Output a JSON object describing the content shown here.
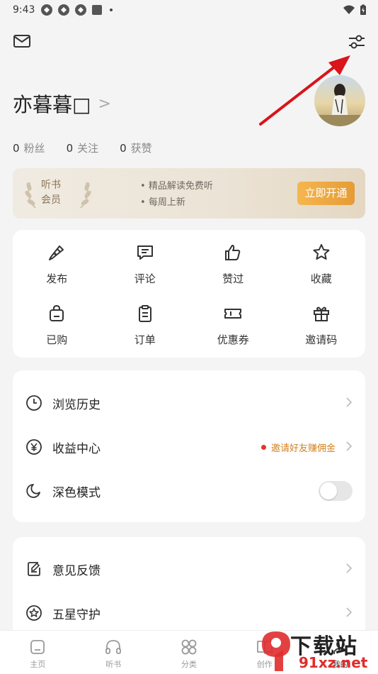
{
  "status_bar": {
    "time": "9:43"
  },
  "header": {
    "mail_icon": "mail-icon",
    "settings_icon": "sliders-icon"
  },
  "profile": {
    "name": "亦暮暮□",
    "chevron": ">"
  },
  "stats": [
    {
      "count": "0",
      "label": "粉丝"
    },
    {
      "count": "0",
      "label": "关注"
    },
    {
      "count": "0",
      "label": "获赞"
    }
  ],
  "vip_banner": {
    "title_line1": "听书",
    "title_line2": "会员",
    "perk1": "精品解读免费听",
    "perk2": "每周上新",
    "cta": "立即开通"
  },
  "quick_actions": [
    {
      "label": "发布",
      "icon": "pen-icon"
    },
    {
      "label": "评论",
      "icon": "comment-icon"
    },
    {
      "label": "赞过",
      "icon": "thumbs-up-icon"
    },
    {
      "label": "收藏",
      "icon": "star-icon"
    },
    {
      "label": "已购",
      "icon": "bag-icon"
    },
    {
      "label": "订单",
      "icon": "clipboard-icon"
    },
    {
      "label": "优惠券",
      "icon": "ticket-icon"
    },
    {
      "label": "邀请码",
      "icon": "gift-icon"
    }
  ],
  "menu": {
    "history": "浏览历史",
    "earnings": "收益中心",
    "earnings_hint": "邀请好友赚佣金",
    "dark_mode": "深色模式",
    "dark_mode_on": false,
    "feedback": "意见反馈",
    "five_star": "五星守护"
  },
  "tab_bar": [
    {
      "label": "主页",
      "icon": "home-icon"
    },
    {
      "label": "听书",
      "icon": "headphones-icon"
    },
    {
      "label": "分类",
      "icon": "grid-icon"
    },
    {
      "label": "创作",
      "icon": "book-icon"
    },
    {
      "label": "我的",
      "icon": "user-icon"
    }
  ],
  "watermark": {
    "text": "下载站",
    "url": "91xz.net"
  },
  "colors": {
    "accent": "#e69b36",
    "hint": "#d4821f",
    "red_dot": "#e5352b",
    "arrow": "#d9141b"
  }
}
